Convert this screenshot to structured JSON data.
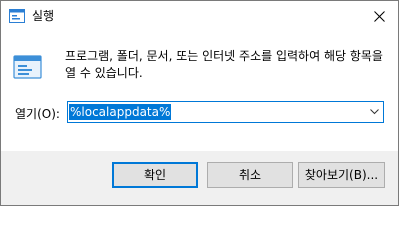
{
  "window": {
    "title": "실행",
    "title_icon": "run-dialog-icon",
    "close_icon": "close-icon"
  },
  "content": {
    "icon": "run-app-icon",
    "description": "프로그램, 폴더, 문서, 또는 인터넷 주소를 입력하여 해당 항목을 열 수 있습니다.",
    "open_label": "열기(O):",
    "open_value": "%localappdata%",
    "dropdown_icon": "chevron-down-icon"
  },
  "buttons": {
    "ok": "확인",
    "cancel": "취소",
    "browse": "찾아보기(B)..."
  },
  "colors": {
    "accent": "#0078d7",
    "dialog_bg": "#f0f0f0",
    "button_bg": "#e1e1e1"
  }
}
